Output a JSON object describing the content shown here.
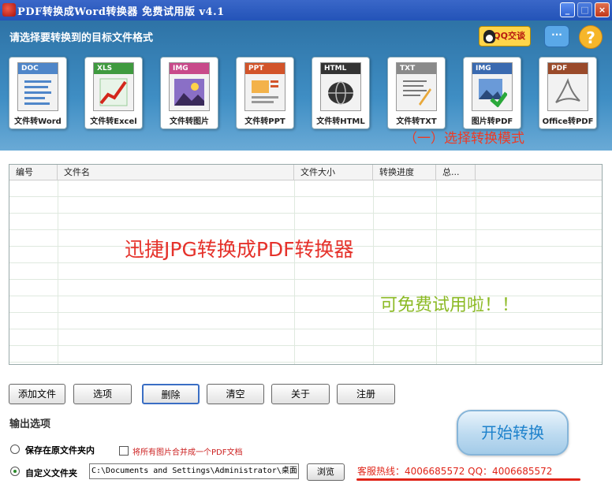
{
  "window": {
    "title": "PDF转换成Word转换器 免费试用版 v4.1",
    "min_label": "_",
    "max_label": "□",
    "close_label": "×"
  },
  "header": {
    "heading": "请选择要转换到的目标文件格式",
    "qq_label": "QQ交谈",
    "chat_label": "···",
    "help_label": "?"
  },
  "modes": [
    {
      "tag": "DOC",
      "label": "文件转Word",
      "color": "#4f86c9"
    },
    {
      "tag": "XLS",
      "label": "文件转Excel",
      "color": "#3f9a3f"
    },
    {
      "tag": "IMG",
      "label": "文件转图片",
      "color": "#c84a8a"
    },
    {
      "tag": "PPT",
      "label": "文件转PPT",
      "color": "#d2542a"
    },
    {
      "tag": "HTML",
      "label": "文件转HTML",
      "color": "#333333"
    },
    {
      "tag": "TXT",
      "label": "文件转TXT",
      "color": "#8a8a8a"
    },
    {
      "tag": "IMG",
      "label": "图片转PDF",
      "color": "#3a6ab0"
    },
    {
      "tag": "PDF",
      "label": "Office转PDF",
      "color": "#9a4a2a"
    }
  ],
  "mode_hint": "（一）选择转换模式",
  "file_list": {
    "columns": [
      "编号",
      "文件名",
      "文件大小",
      "转换进度",
      "总..."
    ],
    "promo_title": "迅捷JPG转换成PDF转换器",
    "promo_sub": "可免费试用啦！！"
  },
  "actions": {
    "add": "添加文件",
    "options": "选项",
    "delete": "删除",
    "clear": "清空",
    "about": "关于",
    "register": "注册"
  },
  "output": {
    "title": "输出选项",
    "save_original": "保存在原文件夹内",
    "merge_label": "将所有图片合并成一个PDF文档",
    "custom_folder": "自定义文件夹",
    "path_value": "C:\\Documents and Settings\\Administrator\\桌面",
    "browse": "浏览"
  },
  "start_label": "开始转换",
  "hotline": "客服热线：4006685572 QQ：4006685572"
}
